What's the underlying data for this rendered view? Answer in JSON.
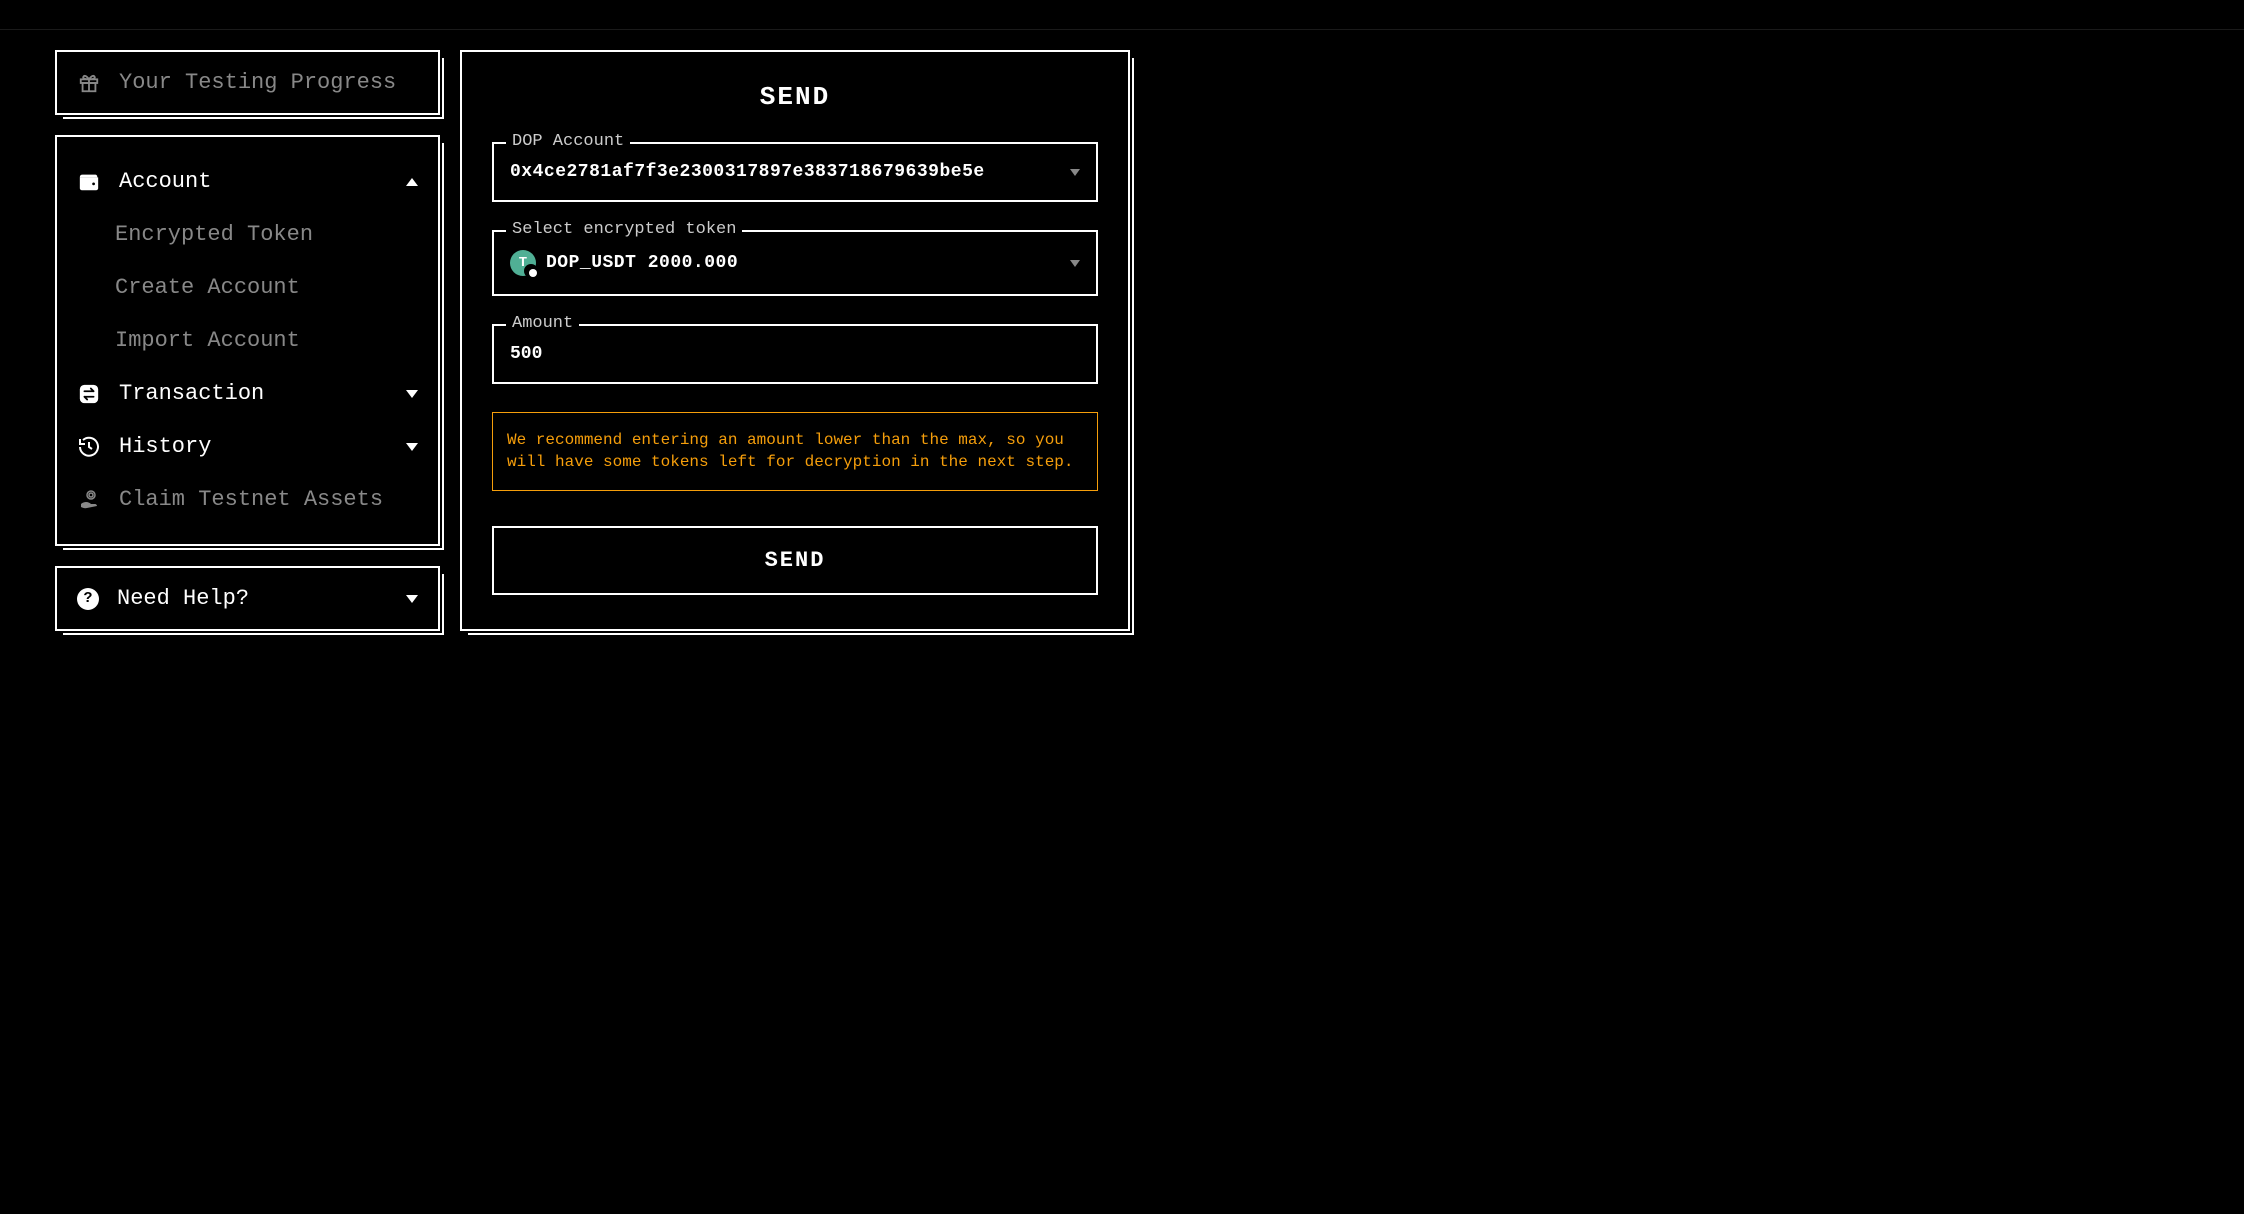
{
  "sidebar": {
    "progress": {
      "label": "Your Testing Progress"
    },
    "nav": {
      "account": {
        "label": "Account",
        "items": [
          {
            "label": "Encrypted Token"
          },
          {
            "label": "Create Account"
          },
          {
            "label": "Import Account"
          }
        ]
      },
      "transaction": {
        "label": "Transaction"
      },
      "history": {
        "label": "History"
      },
      "claim": {
        "label": "Claim Testnet Assets"
      }
    },
    "help": {
      "label": "Need Help?"
    }
  },
  "main": {
    "title": "SEND",
    "dop_account": {
      "label": "DOP Account",
      "value": "0x4ce2781af7f3e2300317897e383718679639be5e"
    },
    "token": {
      "label": "Select encrypted token",
      "value": "DOP_USDT 2000.000"
    },
    "amount": {
      "label": "Amount",
      "value": "500"
    },
    "warning": "We recommend entering an amount lower than the max, so you will have some tokens left for decryption in the next step.",
    "send_button": "SEND"
  }
}
